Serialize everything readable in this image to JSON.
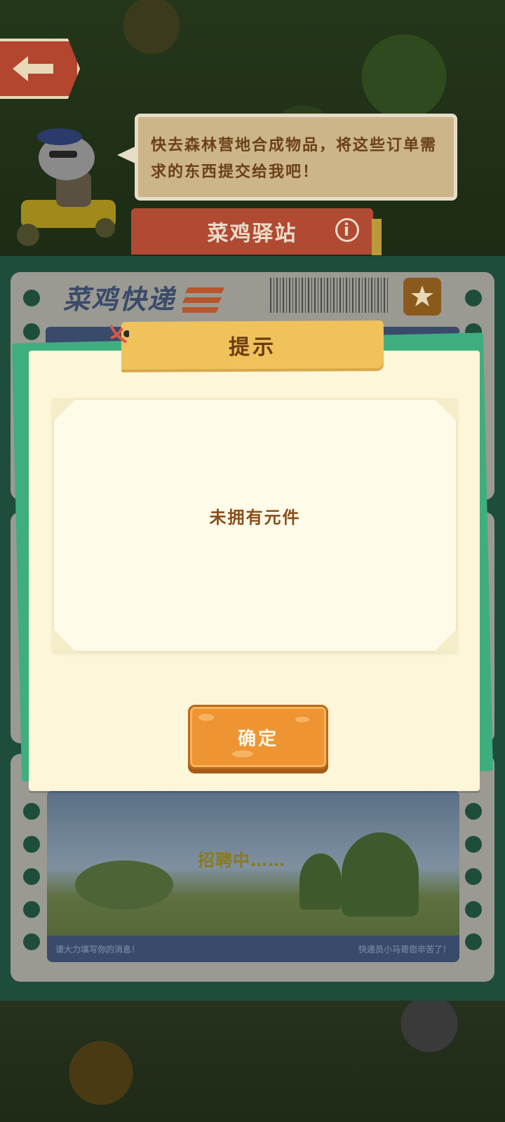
{
  "header": {
    "speech_text": "快去森林营地合成物品，将这些订单需求的东西提交给我吧！",
    "station_title": "菜鸡驿站",
    "info_symbol": "i"
  },
  "board": {
    "logo_text": "菜鸡快递",
    "recruit_text": "招聘中……",
    "footer_left": "请大力填写你的消息！",
    "footer_right": "快递员小马哥您辛苦了！"
  },
  "dialog": {
    "title": "提示",
    "message": "未拥有元件",
    "confirm_label": "确定"
  },
  "colors": {
    "dialog_bg": "#fdf6d8",
    "title_tab": "#f0c25c",
    "confirm_button": "#ef9432",
    "panel_green": "#1f4d3b",
    "accent_green": "#3fae7f"
  },
  "icons": [
    "back-arrow-icon",
    "info-icon",
    "star-icon",
    "ribbon-icon",
    "mascot-character"
  ]
}
